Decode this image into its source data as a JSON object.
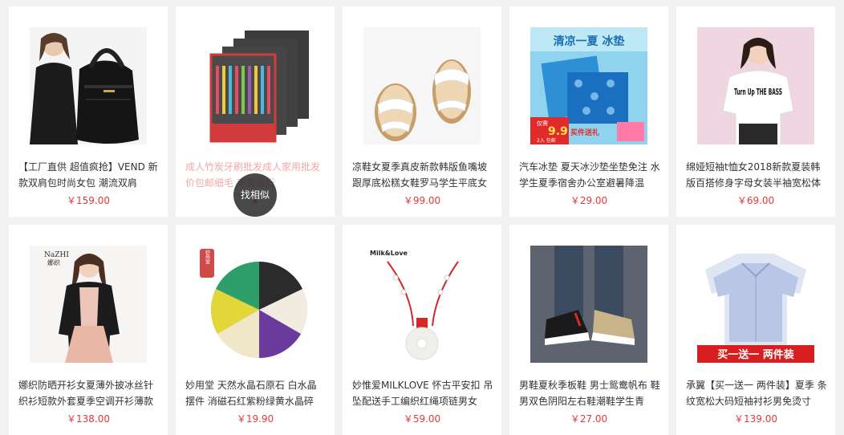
{
  "products": [
    {
      "title": "【工厂直供 超值疯抢】VEND 新款双肩包时尚女包 潮流双肩",
      "price": "￥159.00",
      "image": "backpack-woman"
    },
    {
      "title": "成人竹炭牙刷批发成人家用批发 价包邮细毛  家庭旅行",
      "price": "￥",
      "image": "toothbrush-packs",
      "overlay_button": "找相似"
    },
    {
      "title": "凉鞋女夏季真皮新款韩版鱼嘴坡 跟厚底松糕女鞋罗马学生平底女",
      "price": "￥99.00",
      "image": "white-sandals"
    },
    {
      "title": "汽车冰垫 夏天冰沙垫坐垫免注 水学生夏季宿舍办公室避暑降温",
      "price": "￥29.00",
      "image": "ice-pad",
      "image_text": {
        "banner": "清凉一夏 冰垫",
        "badge_top": "仅需",
        "badge_price": "9.9",
        "badge_unit": "2入 包邮",
        "red_text": "买件送礼"
      }
    },
    {
      "title": "绵娅短袖t恤女2018新款夏装韩 版百搭修身字母女装半袖宽松体",
      "price": "￥69.00",
      "image": "tshirt-woman",
      "image_text": {
        "shirt": "Turn Up THE BASS"
      }
    },
    {
      "title": "娜织防晒开衫女夏薄外披冰丝针 织衫短款外套夏季空调开衫薄款",
      "price": "￥138.00",
      "image": "cardigan-woman",
      "image_text": {
        "logo": "NaZHI",
        "logo_sub": "娜织"
      }
    },
    {
      "title": "妙用堂 天然水晶石原石 白水晶 摆件 消磁石红紫粉绿黄水晶碎",
      "price": "￥19.90",
      "image": "crystal-stones",
      "image_text": {
        "seal": "妙用堂"
      }
    },
    {
      "title": "妙惟爱MILKLOVE 怀古平安扣 吊坠配送手工编织红绳项链男女",
      "price": "￥59.00",
      "image": "jade-pendant",
      "image_text": {
        "brand": "Milk&Love"
      }
    },
    {
      "title": "男鞋夏秋季板鞋 男士鸳鸯帆布 鞋男双色阴阳左右鞋潮鞋学生青",
      "price": "￥27.00",
      "image": "canvas-shoes"
    },
    {
      "title": "承翼【买一送一 两件装】夏季 条纹宽松大码短袖衬衫男免烫寸",
      "price": "￥139.00",
      "image": "shirts",
      "image_text": {
        "banner": "买一送一 两件装"
      }
    }
  ]
}
